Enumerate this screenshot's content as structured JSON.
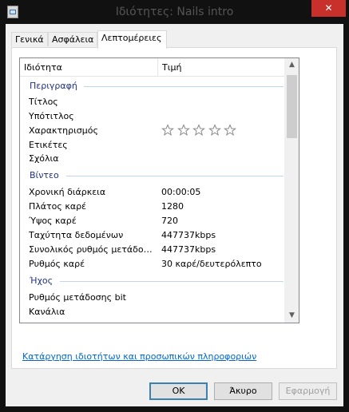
{
  "window": {
    "title": "Ιδιότητες: Nails intro",
    "close_glyph": "✕"
  },
  "tabs": [
    {
      "label": "Γενικά"
    },
    {
      "label": "Ασφάλεια"
    },
    {
      "label": "Λεπτομέρειες"
    }
  ],
  "columns": {
    "property": "Ιδιότητα",
    "value": "Τιμή"
  },
  "groups": {
    "description": {
      "label": "Περιγραφή",
      "rows": [
        {
          "name": "Τίτλος",
          "value": ""
        },
        {
          "name": "Υπότιτλος",
          "value": ""
        },
        {
          "name": "Χαρακτηρισμός",
          "value": "",
          "rating": 0,
          "rating_max": 5
        },
        {
          "name": "Ετικέτες",
          "value": ""
        },
        {
          "name": "Σχόλια",
          "value": ""
        }
      ]
    },
    "video": {
      "label": "Βίντεο",
      "rows": [
        {
          "name": "Χρονική διάρκεια",
          "value": "00:00:05"
        },
        {
          "name": "Πλάτος καρέ",
          "value": "1280"
        },
        {
          "name": "Ύψος καρέ",
          "value": "720"
        },
        {
          "name": "Ταχύτητα δεδομένων",
          "value": "447737kbps"
        },
        {
          "name": "Συνολικός ρυθμός μετάδοσης bit",
          "value": "447737kbps"
        },
        {
          "name": "Ρυθμός καρέ",
          "value": "30 καρέ/δευτερόλεπτο"
        }
      ]
    },
    "audio": {
      "label": "Ήχος",
      "rows": [
        {
          "name": "Ρυθμός μετάδοσης bit",
          "value": ""
        },
        {
          "name": "Κανάλια",
          "value": ""
        }
      ]
    }
  },
  "remove_link": "Κατάργηση ιδιοτήτων και προσωπικών πληροφοριών",
  "buttons": {
    "ok": "OK",
    "cancel": "Άκυρο",
    "apply": "Εφαρμογή"
  },
  "colors": {
    "group_header": "#1e3287",
    "link": "#0066cc",
    "close": "#c7302b"
  }
}
